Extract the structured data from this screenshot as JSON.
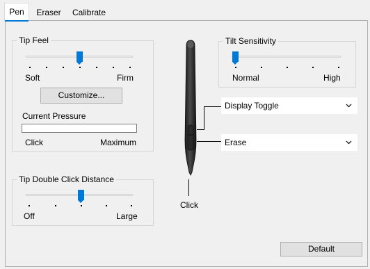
{
  "tabs": [
    {
      "label": "Pen",
      "active": true
    },
    {
      "label": "Eraser",
      "active": false
    },
    {
      "label": "Calibrate",
      "active": false
    }
  ],
  "tip_feel": {
    "title": "Tip Feel",
    "min_label": "Soft",
    "max_label": "Firm",
    "level_index": 3,
    "level_count": 7,
    "customize_label": "Customize...",
    "pressure_title": "Current Pressure",
    "pressure_value": 0,
    "pressure_min_label": "Click",
    "pressure_max_label": "Maximum"
  },
  "tilt": {
    "title": "Tilt Sensitivity",
    "min_label": "Normal",
    "max_label": "High",
    "level_index": 0,
    "level_count": 5
  },
  "double_click": {
    "title": "Tip Double Click Distance",
    "min_label": "Off",
    "max_label": "Large",
    "level_index": 2,
    "level_count": 5
  },
  "pen": {
    "upper_button_action": "Display Toggle",
    "lower_button_action": "Erase",
    "tip_action": "Click"
  },
  "default_label": "Default",
  "colors": {
    "accent": "#0078d7"
  }
}
